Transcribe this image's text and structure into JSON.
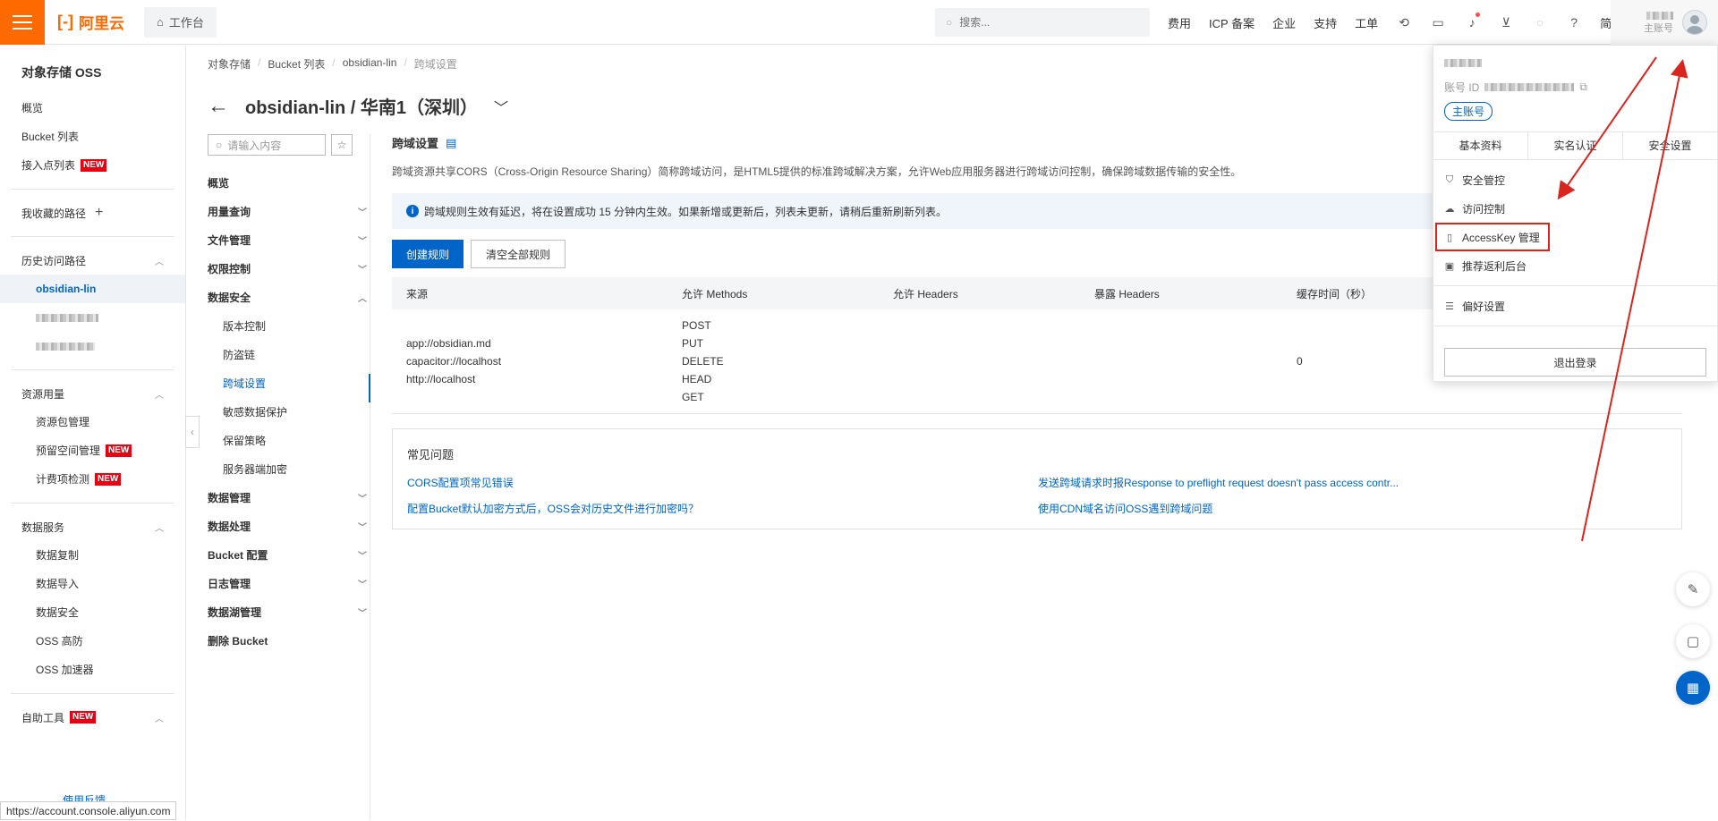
{
  "topbar": {
    "logo_text": "阿里云",
    "workbench": "工作台",
    "search_placeholder": "搜索...",
    "links": [
      "费用",
      "ICP 备案",
      "企业",
      "支持",
      "工单"
    ],
    "lang": "简体",
    "account_label": "主账号",
    "brand_color": "#ff6a00"
  },
  "sidebar": {
    "title": "对象存储 OSS",
    "items": [
      {
        "label": "概览"
      },
      {
        "label": "Bucket 列表"
      },
      {
        "label": "接入点列表",
        "badge": "NEW"
      }
    ],
    "favorites": "我收藏的路径",
    "history": {
      "label": "历史访问路径",
      "items": [
        "obsidian-lin"
      ]
    },
    "resource": {
      "label": "资源用量",
      "items": [
        {
          "label": "资源包管理"
        },
        {
          "label": "预留空间管理",
          "badge": "NEW"
        },
        {
          "label": "计费项检测",
          "badge": "NEW"
        }
      ]
    },
    "data_service": {
      "label": "数据服务",
      "items": [
        "数据复制",
        "数据导入",
        "数据安全",
        "OSS 高防",
        "OSS 加速器"
      ]
    },
    "tools": {
      "label": "自助工具",
      "badge": "NEW"
    },
    "feedback": "使用反馈"
  },
  "status_url": "https://account.console.aliyun.com",
  "breadcrumb": [
    "对象存储",
    "Bucket 列表",
    "obsidian-lin",
    "跨域设置"
  ],
  "page_title": "obsidian-lin / 华南1（深圳）",
  "subnav": {
    "search_placeholder": "请输入内容",
    "items": [
      {
        "label": "概览",
        "expandable": false
      },
      {
        "label": "用量查询",
        "expandable": true
      },
      {
        "label": "文件管理",
        "expandable": true
      },
      {
        "label": "权限控制",
        "expandable": true
      },
      {
        "label": "数据安全",
        "expandable": true,
        "open": true
      }
    ],
    "security_children": [
      "版本控制",
      "防盗链",
      "跨域设置",
      "敏感数据保护",
      "保留策略",
      "服务器端加密"
    ],
    "after": [
      {
        "label": "数据管理",
        "expandable": true
      },
      {
        "label": "数据处理",
        "expandable": true
      },
      {
        "label": "Bucket 配置",
        "expandable": true
      },
      {
        "label": "日志管理",
        "expandable": true
      },
      {
        "label": "数据湖管理",
        "expandable": true
      },
      {
        "label": "删除 Bucket",
        "expandable": false
      }
    ]
  },
  "content": {
    "title": "跨域设置",
    "description": "跨域资源共享CORS（Cross-Origin Resource Sharing）简称跨域访问，是HTML5提供的标准跨域解决方案，允许Web应用服务器进行跨域访问控制，确保跨域数据传输的安全性。",
    "notice": "跨域规则生效有延迟，将在设置成功 15 分钟内生效。如果新增或更新后，列表未更新，请稍后重新刷新列表。",
    "create_button": "创建规则",
    "clear_button": "清空全部规则",
    "table": {
      "headers": [
        "来源",
        "允许 Methods",
        "允许 Headers",
        "暴露 Headers",
        "缓存时间（秒）"
      ],
      "rows": [
        {
          "origins": [
            "app://obsidian.md",
            "capacitor://localhost",
            "http://localhost"
          ],
          "methods": [
            "POST",
            "PUT",
            "DELETE",
            "HEAD",
            "GET"
          ],
          "allow_headers": "",
          "expose_headers": "",
          "cache": "0"
        }
      ]
    },
    "faq": {
      "title": "常见问题",
      "links": [
        "CORS配置项常见错误",
        "发送跨域请求时报Response to preflight request doesn't pass access contr...",
        "配置Bucket默认加密方式后，OSS会对历史文件进行加密吗？",
        "使用CDN域名访问OSS遇到跨域问题"
      ]
    }
  },
  "account_dropdown": {
    "id_label": "账号 ID",
    "role": "主账号",
    "tabs": [
      "基本资料",
      "实名认证",
      "安全设置"
    ],
    "menu": [
      {
        "label": "安全管控",
        "icon": "shield-icon"
      },
      {
        "label": "访问控制",
        "icon": "cloud-icon"
      },
      {
        "label": "AccessKey 管理",
        "icon": "key-icon"
      },
      {
        "label": "推荐返利后台",
        "icon": "gift-icon"
      }
    ],
    "preferences": "偏好设置",
    "logout": "退出登录"
  }
}
